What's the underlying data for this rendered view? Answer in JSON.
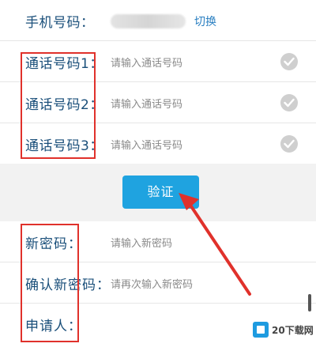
{
  "form": {
    "phone_label": "手机号码：",
    "switch_label": "切换",
    "call_numbers": [
      {
        "label": "通话号码1：",
        "placeholder": "请输入通话号码"
      },
      {
        "label": "通话号码2：",
        "placeholder": "请输入通话号码"
      },
      {
        "label": "通话号码3：",
        "placeholder": "请输入通话号码"
      }
    ],
    "verify_button": "验证",
    "new_password_label": "新密码：",
    "new_password_placeholder": "请输入新密码",
    "confirm_password_label": "确认新密码：",
    "confirm_password_placeholder": "请再次输入新密码",
    "applicant_label": "申请人："
  },
  "watermark": {
    "text": "20下载网"
  },
  "colors": {
    "accent": "#1fa3e0",
    "annotation": "#e0312b",
    "label": "#1a4f7a",
    "link": "#2a7fc1"
  },
  "icons": {
    "check": "check-circle-icon",
    "logo": "box-logo-icon"
  }
}
